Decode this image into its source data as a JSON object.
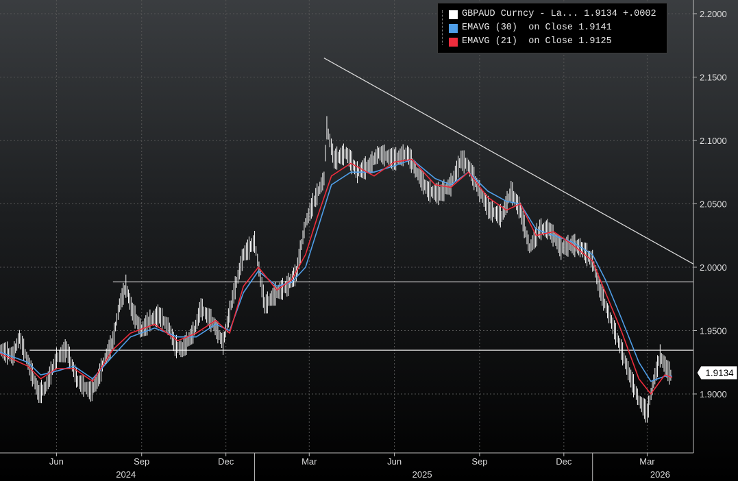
{
  "chart_data": {
    "type": "line",
    "y_axis": {
      "ticks": [
        "2.2000",
        "2.1500",
        "2.1000",
        "2.0500",
        "2.0000",
        "1.9500",
        "1.9000"
      ],
      "tick_values": [
        2.2,
        2.15,
        2.1,
        2.05,
        2.0,
        1.95,
        1.9
      ],
      "ylim": [
        1.8535,
        2.2108
      ],
      "side": "right"
    },
    "x_axis": {
      "range": [
        "2024-04-01",
        "2026-04-20"
      ],
      "month_ticks": [
        {
          "label": "Jun",
          "date": "2024-06-01"
        },
        {
          "label": "Sep",
          "date": "2024-09-01"
        },
        {
          "label": "Dec",
          "date": "2024-12-01"
        },
        {
          "label": "Mar",
          "date": "2025-03-01"
        },
        {
          "label": "Jun",
          "date": "2025-06-01"
        },
        {
          "label": "Sep",
          "date": "2025-09-01"
        },
        {
          "label": "Dec",
          "date": "2025-12-01"
        },
        {
          "label": "Mar",
          "date": "2026-03-01"
        }
      ],
      "year_labels": [
        {
          "label": "2024",
          "date": "2024-08-15"
        },
        {
          "label": "2025",
          "date": "2025-07-01"
        },
        {
          "label": "2026",
          "date": "2026-03-15"
        }
      ],
      "year_separators": [
        "2025-01-01",
        "2026-01-01"
      ]
    },
    "grid": true,
    "legend_position": "top-right",
    "legend": [
      {
        "label": "GBPAUD Curncy - La...",
        "value": "1.9134",
        "change": "+.0002",
        "color": "#ffffff"
      },
      {
        "label": "EMAVG (30)  on Close",
        "value": "1.9141",
        "color": "#4f9ee8"
      },
      {
        "label": "EMAVG (21)  on Close",
        "value": "1.9125",
        "color": "#ee2c3c"
      }
    ],
    "last_value_tag": "1.9134",
    "horizontal_lines": [
      {
        "y": 1.9884,
        "from": "2024-08-01"
      },
      {
        "y": 1.9345,
        "from": "2024-05-03"
      }
    ],
    "trendline": {
      "from": {
        "date": "2025-03-17",
        "y": 2.165
      },
      "to": {
        "date": "2026-04-20",
        "y": 2.0025
      }
    },
    "series": [
      {
        "name": "GBPAUD Curncy",
        "color": "#ffffff",
        "style": "high-low bars",
        "points": [
          [
            "2024-04-01",
            1.935
          ],
          [
            "2024-04-15",
            1.93
          ],
          [
            "2024-04-22",
            1.945
          ],
          [
            "2024-05-06",
            1.915
          ],
          [
            "2024-05-13",
            1.9
          ],
          [
            "2024-05-20",
            1.905
          ],
          [
            "2024-06-01",
            1.928
          ],
          [
            "2024-06-12",
            1.935
          ],
          [
            "2024-06-24",
            1.91
          ],
          [
            "2024-07-08",
            1.902
          ],
          [
            "2024-07-15",
            1.91
          ],
          [
            "2024-07-22",
            1.925
          ],
          [
            "2024-08-01",
            1.942
          ],
          [
            "2024-08-08",
            1.97
          ],
          [
            "2024-08-15",
            1.985
          ],
          [
            "2024-08-22",
            1.965
          ],
          [
            "2024-09-01",
            1.95
          ],
          [
            "2024-09-10",
            1.958
          ],
          [
            "2024-09-20",
            1.962
          ],
          [
            "2024-10-01",
            1.952
          ],
          [
            "2024-10-07",
            1.938
          ],
          [
            "2024-10-15",
            1.935
          ],
          [
            "2024-10-28",
            1.95
          ],
          [
            "2024-11-04",
            1.968
          ],
          [
            "2024-11-18",
            1.955
          ],
          [
            "2024-11-28",
            1.94
          ],
          [
            "2024-12-08",
            1.975
          ],
          [
            "2024-12-20",
            2.01
          ],
          [
            "2025-01-01",
            2.02
          ],
          [
            "2025-01-12",
            1.97
          ],
          [
            "2025-01-25",
            1.98
          ],
          [
            "2025-02-05",
            1.985
          ],
          [
            "2025-02-15",
            1.995
          ],
          [
            "2025-02-25",
            2.035
          ],
          [
            "2025-03-08",
            2.055
          ],
          [
            "2025-03-17",
            2.07
          ],
          [
            "2025-03-20",
            2.11
          ],
          [
            "2025-03-28",
            2.085
          ],
          [
            "2025-04-10",
            2.09
          ],
          [
            "2025-04-22",
            2.075
          ],
          [
            "2025-05-05",
            2.08
          ],
          [
            "2025-05-15",
            2.09
          ],
          [
            "2025-06-01",
            2.085
          ],
          [
            "2025-06-15",
            2.09
          ],
          [
            "2025-06-25",
            2.075
          ],
          [
            "2025-07-08",
            2.06
          ],
          [
            "2025-07-20",
            2.058
          ],
          [
            "2025-08-01",
            2.065
          ],
          [
            "2025-08-12",
            2.085
          ],
          [
            "2025-08-20",
            2.08
          ],
          [
            "2025-09-01",
            2.06
          ],
          [
            "2025-09-12",
            2.045
          ],
          [
            "2025-09-25",
            2.04
          ],
          [
            "2025-10-05",
            2.06
          ],
          [
            "2025-10-15",
            2.045
          ],
          [
            "2025-10-25",
            2.015
          ],
          [
            "2025-11-05",
            2.03
          ],
          [
            "2025-11-15",
            2.03
          ],
          [
            "2025-11-28",
            2.015
          ],
          [
            "2025-12-10",
            2.018
          ],
          [
            "2025-12-20",
            2.015
          ],
          [
            "2026-01-01",
            2.005
          ],
          [
            "2026-01-10",
            1.98
          ],
          [
            "2026-01-20",
            1.96
          ],
          [
            "2026-02-01",
            1.935
          ],
          [
            "2026-02-10",
            1.915
          ],
          [
            "2026-02-20",
            1.895
          ],
          [
            "2026-03-01",
            1.885
          ],
          [
            "2026-03-08",
            1.91
          ],
          [
            "2026-03-15",
            1.93
          ],
          [
            "2026-03-22",
            1.92
          ],
          [
            "2026-03-28",
            1.913
          ]
        ]
      },
      {
        "name": "EMAVG (30)",
        "color": "#4f9ee8",
        "points": [
          [
            "2024-04-01",
            1.933
          ],
          [
            "2024-05-01",
            1.925
          ],
          [
            "2024-05-15",
            1.915
          ],
          [
            "2024-06-01",
            1.918
          ],
          [
            "2024-06-20",
            1.922
          ],
          [
            "2024-07-10",
            1.912
          ],
          [
            "2024-08-01",
            1.93
          ],
          [
            "2024-08-20",
            1.945
          ],
          [
            "2024-09-15",
            1.952
          ],
          [
            "2024-10-10",
            1.945
          ],
          [
            "2024-10-30",
            1.945
          ],
          [
            "2024-11-20",
            1.955
          ],
          [
            "2024-12-05",
            1.95
          ],
          [
            "2024-12-20",
            1.98
          ],
          [
            "2025-01-05",
            1.997
          ],
          [
            "2025-01-25",
            1.985
          ],
          [
            "2025-02-10",
            1.988
          ],
          [
            "2025-02-25",
            2.0
          ],
          [
            "2025-03-10",
            2.03
          ],
          [
            "2025-03-25",
            2.065
          ],
          [
            "2025-04-15",
            2.075
          ],
          [
            "2025-05-10",
            2.075
          ],
          [
            "2025-06-01",
            2.08
          ],
          [
            "2025-06-20",
            2.085
          ],
          [
            "2025-07-15",
            2.07
          ],
          [
            "2025-08-01",
            2.065
          ],
          [
            "2025-08-20",
            2.075
          ],
          [
            "2025-09-10",
            2.06
          ],
          [
            "2025-09-30",
            2.052
          ],
          [
            "2025-10-15",
            2.05
          ],
          [
            "2025-11-01",
            2.03
          ],
          [
            "2025-11-20",
            2.025
          ],
          [
            "2025-12-10",
            2.02
          ],
          [
            "2026-01-01",
            2.01
          ],
          [
            "2026-01-15",
            1.99
          ],
          [
            "2026-02-01",
            1.96
          ],
          [
            "2026-02-20",
            1.925
          ],
          [
            "2026-03-05",
            1.91
          ],
          [
            "2026-03-20",
            1.914
          ],
          [
            "2026-03-28",
            1.914
          ]
        ]
      },
      {
        "name": "EMAVG (21)",
        "color": "#ee2c3c",
        "points": [
          [
            "2024-04-01",
            1.932
          ],
          [
            "2024-05-01",
            1.922
          ],
          [
            "2024-05-15",
            1.912
          ],
          [
            "2024-06-01",
            1.92
          ],
          [
            "2024-06-20",
            1.92
          ],
          [
            "2024-07-10",
            1.91
          ],
          [
            "2024-08-01",
            1.935
          ],
          [
            "2024-08-20",
            1.948
          ],
          [
            "2024-09-15",
            1.955
          ],
          [
            "2024-10-10",
            1.942
          ],
          [
            "2024-10-30",
            1.948
          ],
          [
            "2024-11-20",
            1.958
          ],
          [
            "2024-12-05",
            1.948
          ],
          [
            "2024-12-20",
            1.985
          ],
          [
            "2025-01-05",
            2.0
          ],
          [
            "2025-01-25",
            1.982
          ],
          [
            "2025-02-10",
            1.99
          ],
          [
            "2025-02-25",
            2.01
          ],
          [
            "2025-03-10",
            2.04
          ],
          [
            "2025-03-25",
            2.072
          ],
          [
            "2025-04-15",
            2.082
          ],
          [
            "2025-05-10",
            2.072
          ],
          [
            "2025-06-01",
            2.083
          ],
          [
            "2025-06-20",
            2.085
          ],
          [
            "2025-07-15",
            2.065
          ],
          [
            "2025-08-01",
            2.063
          ],
          [
            "2025-08-20",
            2.075
          ],
          [
            "2025-09-10",
            2.055
          ],
          [
            "2025-09-30",
            2.045
          ],
          [
            "2025-10-15",
            2.05
          ],
          [
            "2025-11-01",
            2.025
          ],
          [
            "2025-11-20",
            2.028
          ],
          [
            "2025-12-10",
            2.018
          ],
          [
            "2026-01-01",
            2.005
          ],
          [
            "2026-01-15",
            1.98
          ],
          [
            "2026-02-01",
            1.95
          ],
          [
            "2026-02-20",
            1.912
          ],
          [
            "2026-03-05",
            1.9
          ],
          [
            "2026-03-20",
            1.915
          ],
          [
            "2026-03-28",
            1.913
          ]
        ]
      }
    ]
  }
}
